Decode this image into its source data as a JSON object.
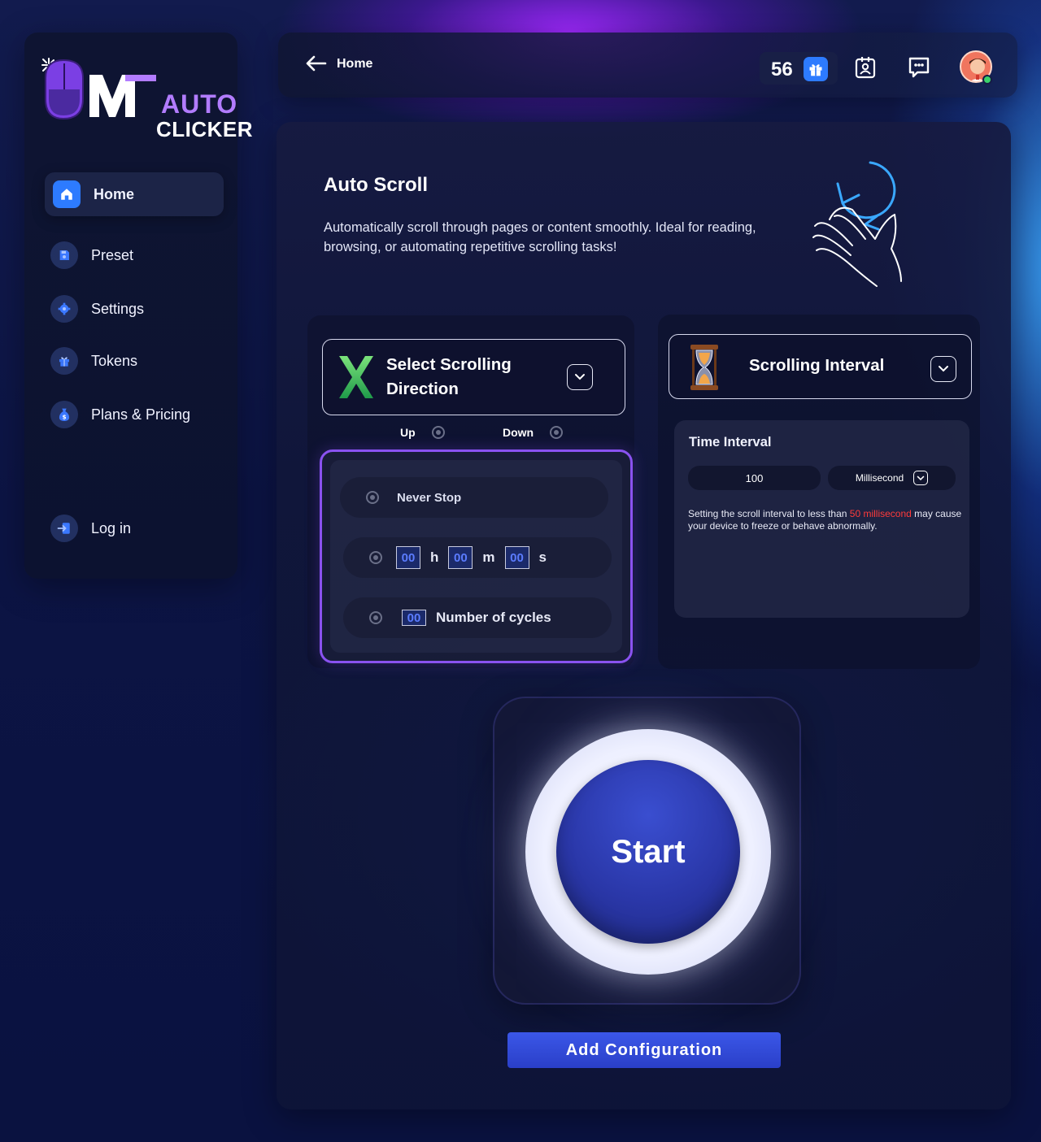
{
  "brand": {
    "logo_top": "AUTO",
    "logo_bottom": "CLICKER"
  },
  "sidebar": {
    "items": [
      {
        "label": "Home",
        "icon": "home-icon",
        "active": true
      },
      {
        "label": "Preset",
        "icon": "save-icon"
      },
      {
        "label": "Settings",
        "icon": "gear-icon"
      },
      {
        "label": "Tokens",
        "icon": "gift-icon"
      },
      {
        "label": "Plans & Pricing",
        "icon": "money-bag-icon"
      }
    ],
    "login_label": "Log in"
  },
  "topbar": {
    "breadcrumb": "Home",
    "token_count": "56",
    "accent": "#2d7bff"
  },
  "page": {
    "title": "Auto Scroll",
    "description": "Automatically scroll through pages or content smoothly. Ideal for reading, browsing, or automating repetitive scrolling tasks!"
  },
  "direction": {
    "label": "Select Scrolling Direction",
    "options": [
      "Up",
      "Down"
    ]
  },
  "stop_options": {
    "never_stop": "Never Stop",
    "hours": "00",
    "hours_unit": "h",
    "minutes": "00",
    "minutes_unit": "m",
    "seconds": "00",
    "seconds_unit": "s",
    "cycles": "00",
    "cycles_label": "Number of cycles"
  },
  "interval": {
    "label": "Scrolling Interval",
    "time_label": "Time Interval",
    "value": "100",
    "unit": "Millisecond",
    "warning_pre": "Setting the scroll interval to less than ",
    "warning_highlight": "50 millisecond",
    "warning_post": " may cause your device to freeze or behave abnormally."
  },
  "actions": {
    "start_label": "Start",
    "add_config_label": "Add Configuration"
  },
  "colors": {
    "highlight_border": "#8a52f0",
    "warning_red": "#ff3b3b",
    "start_blue": "#2a37a8"
  }
}
